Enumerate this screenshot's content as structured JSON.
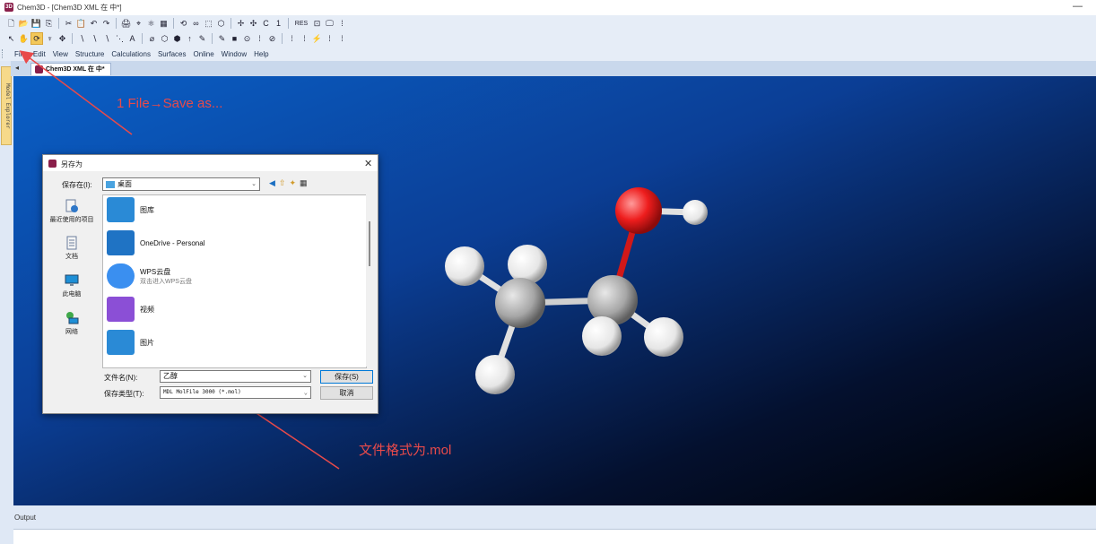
{
  "window": {
    "title": "Chem3D - [Chem3D XML 在 中*]",
    "minimize_glyph": "—"
  },
  "toolbar_row1": [
    "🗋",
    "📂",
    "💾",
    "⎘",
    "✂",
    "📋",
    "↶",
    "↷",
    "🖨",
    "⌖",
    "⚛",
    "▦",
    "⟲",
    "∞",
    "⬚",
    "⬡",
    "✢",
    "✣",
    "C",
    "1",
    "RES",
    "⊡",
    "🖵",
    "⁞"
  ],
  "toolbar_row2": [
    "↖",
    "✋",
    "⟳",
    "♆",
    "✥",
    "∖",
    "∖",
    "∖",
    "⋱",
    "A",
    "⌀",
    "⬡",
    "⬢",
    "↑",
    "✎",
    "✎",
    "■",
    "⊙",
    "⁞",
    "⊘",
    "⁞",
    "⁞",
    "⚡",
    "⁞",
    "⁞"
  ],
  "menu": [
    "File",
    "Edit",
    "View",
    "Structure",
    "Calculations",
    "Surfaces",
    "Online",
    "Window",
    "Help"
  ],
  "model_explorer_label": "Model Explorer",
  "doc_tab": {
    "nav": "◂",
    "label": "Chem3D XML 在 中*"
  },
  "annotations": {
    "step1": "1 File→Save as...",
    "step2": "文件格式为.mol"
  },
  "save_dialog": {
    "title": "另存为",
    "close_glyph": "✕",
    "save_in_label": "保存在(I):",
    "save_in_value": "桌面",
    "places": [
      "最近使用的项目",
      "文档",
      "此电脑",
      "网络"
    ],
    "items": [
      {
        "name": "图库",
        "sub": ""
      },
      {
        "name": "OneDrive - Personal",
        "sub": ""
      },
      {
        "name": "WPS云盘",
        "sub": "双击进入WPS云盘"
      },
      {
        "name": "视频",
        "sub": ""
      },
      {
        "name": "图片",
        "sub": ""
      }
    ],
    "filename_label": "文件名(N):",
    "filename_value": "乙醇",
    "filetype_label": "保存类型(T):",
    "filetype_value": "MDL MolFile 3000 (*.mol)",
    "save_button": "保存(S)",
    "cancel_button": "取消"
  },
  "output_label": "Output",
  "colors": {
    "annotation": "#e84a4a",
    "oxygen": "#ee1d1d",
    "carbon": "#a6a6a6",
    "hydrogen": "#f2f2f2"
  }
}
